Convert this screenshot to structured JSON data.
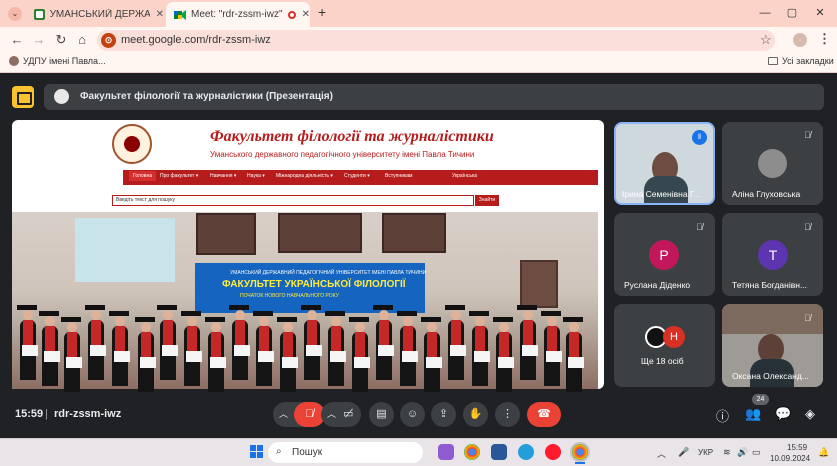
{
  "browser": {
    "tabs": [
      {
        "title": "УМАНСЬКИЙ ДЕРЖАВНИЙ П",
        "active": false
      },
      {
        "title": "Meet: \"rdr-zssm-iwz\"",
        "active": true
      }
    ],
    "new_tab": "+",
    "url": "meet.google.com/rdr-zssm-iwz",
    "bookmark_1": "УДПУ імені Павла...",
    "all_bookmarks": "Усі закладки",
    "controls": {
      "minimize": "—",
      "maximize": "▢",
      "close": "✕"
    }
  },
  "meet": {
    "presenting_title": "Факультет філології та журналістики (Презентація)",
    "time": "15:59",
    "meeting_code": "rdr-zssm-iwz",
    "people_count": "24",
    "participants": [
      {
        "name": "Ірина Семенівна Г...",
        "speaking": true,
        "type": "video"
      },
      {
        "name": "Аліна Глуховська",
        "type": "photo"
      },
      {
        "name": "Руслана Діденко",
        "initial": "Р",
        "color": "#c2185b"
      },
      {
        "name": "Тетяна Богданівн...",
        "initial": "Т",
        "color": "#5e35b1"
      },
      {
        "name": "Ще 18 осіб",
        "initial": "Н",
        "color": "#d93025"
      },
      {
        "name": "Оксана Олександ...",
        "type": "video"
      }
    ]
  },
  "presentation": {
    "site_title": "Факультет філології та журналістики",
    "site_subtitle": "Уманського державного педагогічного університету імені Павла Тичини",
    "nav": [
      "Головна",
      "Про факультет ▾",
      "Навчання ▾",
      "Наука ▾",
      "Міжнародна діяльність ▾",
      "Студенти ▾",
      "Вступникам",
      "Українська"
    ],
    "search_placeholder": "Введіть текст для пошуку",
    "search_button": "Знайти",
    "banner_line1": "УМАНСЬКИЙ ДЕРЖАВНИЙ ПЕДАГОГІЧНИЙ УНІВЕРСИТЕТ ІМЕНІ ПАВЛА ТИЧИНИ",
    "banner_line2": "ФАКУЛЬТЕТ УКРАЇНСЬКОЇ ФІЛОЛОГІЇ",
    "banner_line3": "ПОЧАТОК НОВОГО НАВЧАЛЬНОГО РОКУ"
  },
  "taskbar": {
    "search": "Пошук",
    "lang": "УКР",
    "time": "15:59",
    "date": "10.09.2024"
  }
}
